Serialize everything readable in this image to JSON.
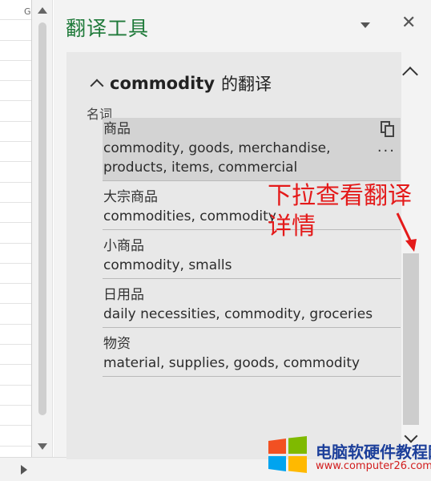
{
  "sheet": {
    "corner_label": "G"
  },
  "pane": {
    "title": "翻译工具",
    "section": {
      "word": "commodity",
      "suffix": "的翻译",
      "part_of_speech": "名词",
      "entries": [
        {
          "head": "商品",
          "synonyms": "commodity, goods, merchandise, products, items, commercial",
          "highlighted": true
        },
        {
          "head": "大宗商品",
          "synonyms": "commodities, commodity"
        },
        {
          "head": "小商品",
          "synonyms": "commodity, smalls"
        },
        {
          "head": "日用品",
          "synonyms": "daily necessities, commodity, groceries"
        },
        {
          "head": "物资",
          "synonyms": "material, supplies, goods, commodity"
        }
      ],
      "more_label": "···"
    }
  },
  "annotation": {
    "line1": "下拉查看翻译",
    "line2": "详情",
    "color": "#e41a1a"
  },
  "watermark": {
    "title": "电脑软硬件教程网",
    "url": "www.computer26.com"
  },
  "colors": {
    "title": "#1f7a3a",
    "annotation": "#e41a1a"
  }
}
